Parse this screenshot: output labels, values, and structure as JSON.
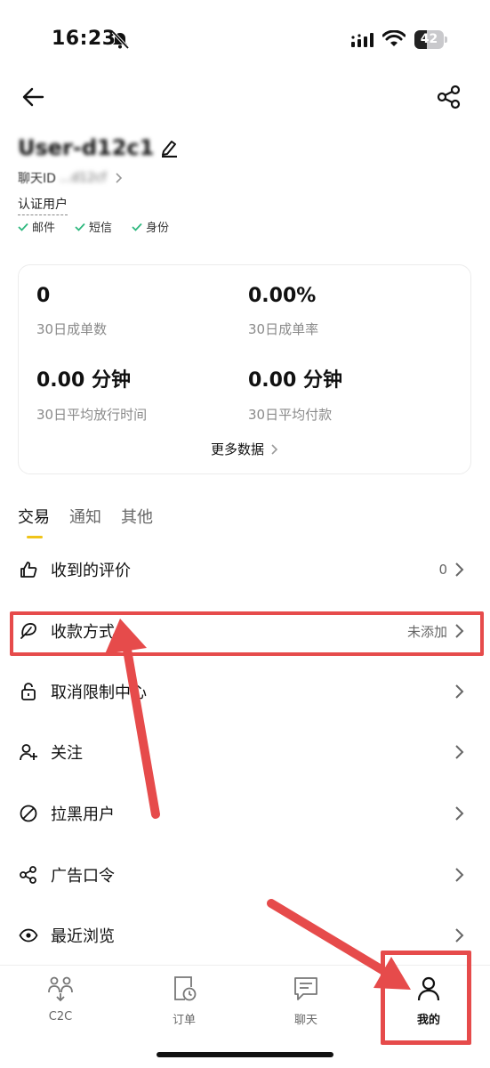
{
  "status_bar": {
    "time": "16:23",
    "battery": "42",
    "battery_level": 0.42
  },
  "profile": {
    "username": "User-d12c1",
    "chat_id_label": "聊天ID",
    "chat_id_value": "...d12cf",
    "verified_label": "认证用户",
    "badges": [
      "邮件",
      "短信",
      "身份"
    ]
  },
  "stats": {
    "completed_orders_value": "0",
    "completed_orders_label": "30日成单数",
    "completion_rate_value": "0.00%",
    "completion_rate_label": "30日成单率",
    "avg_release_value": "0.00 分钟",
    "avg_release_label": "30日平均放行时间",
    "avg_pay_value": "0.00 分钟",
    "avg_pay_label": "30日平均付款",
    "more_data_label": "更多数据"
  },
  "tabs": [
    "交易",
    "通知",
    "其他"
  ],
  "menu": {
    "reviews": {
      "label": "收到的评价",
      "value": "0"
    },
    "payment": {
      "label": "收款方式",
      "value": "未添加"
    },
    "unrestrict": {
      "label": "取消限制中心"
    },
    "follow": {
      "label": "关注"
    },
    "blocked": {
      "label": "拉黑用户"
    },
    "ad_code": {
      "label": "广告口令"
    },
    "recent": {
      "label": "最近浏览"
    }
  },
  "bottom_nav": {
    "c2c": "C2C",
    "orders": "订单",
    "chat": "聊天",
    "me": "我的"
  },
  "colors": {
    "accent": "#f0c419",
    "annotation_red": "#e64b4b",
    "check_green": "#2eb87e"
  }
}
